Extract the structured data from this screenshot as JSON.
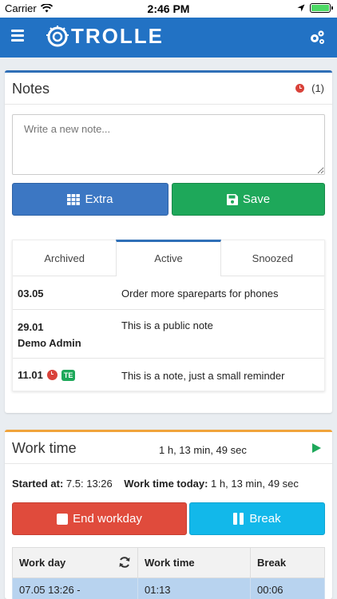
{
  "status_bar": {
    "carrier": "Carrier",
    "time": "2:46 PM"
  },
  "navbar": {
    "logo_text": "TROLLE",
    "brand_color": "#2272c4"
  },
  "notes": {
    "title": "Notes",
    "count": "(1)",
    "placeholder": "Write a new note...",
    "extra_label": "Extra",
    "save_label": "Save",
    "tabs": [
      {
        "label": "Archived",
        "active": false
      },
      {
        "label": "Active",
        "active": true
      },
      {
        "label": "Snoozed",
        "active": false
      }
    ],
    "items": [
      {
        "date": "03.05",
        "author": "",
        "text": "Order more spareparts for phones"
      },
      {
        "date": "29.01",
        "author": "Demo Admin",
        "text": "This is a public note"
      },
      {
        "date": "11.01",
        "author": "",
        "badge": "TE",
        "text": "This is a note, just a small reminder"
      }
    ]
  },
  "work_time": {
    "title": "Work time",
    "duration": "1 h, 13 min, 49 sec",
    "started_label": "Started at:",
    "started_value": "7.5: 13:26",
    "today_label": "Work time today:",
    "today_value": "1 h, 13 min, 49 sec",
    "end_label": "End workday",
    "break_label": "Break",
    "table": {
      "headers": [
        "Work day",
        "Work time",
        "Break"
      ],
      "rows": [
        [
          "07.05 13:26 -",
          "01:13",
          "00:06"
        ]
      ]
    }
  }
}
